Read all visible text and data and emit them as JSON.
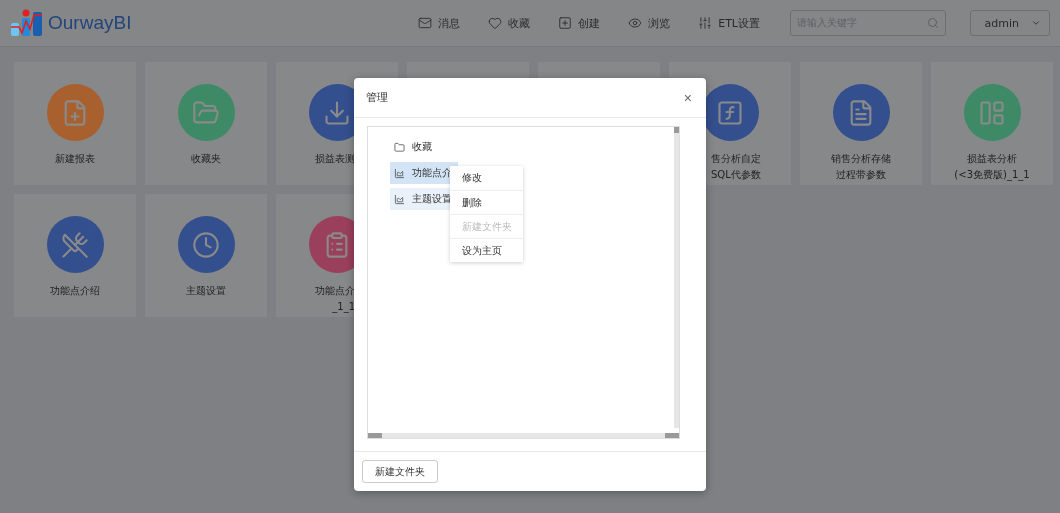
{
  "header": {
    "logo": "OurwayBI",
    "nav": [
      {
        "label": "消息"
      },
      {
        "label": "收藏"
      },
      {
        "label": "创建"
      },
      {
        "label": "浏览"
      },
      {
        "label": "ETL设置"
      }
    ],
    "search": {
      "placeholder": "请输入关键字"
    },
    "user": "admin"
  },
  "tiles": [
    {
      "kind": "app",
      "lines": [
        "新建报表"
      ],
      "color": "#a8602f"
    },
    {
      "kind": "app",
      "lines": [
        "收藏夹"
      ],
      "color": "#3e8a66"
    },
    {
      "kind": "cut_right",
      "lines": [
        "损益表测"
      ],
      "color": "#344f8e"
    },
    {
      "kind": "covered"
    },
    {
      "kind": "covered"
    },
    {
      "kind": "cut_left",
      "lines": [
        "售分析自定",
        "SQL代参数"
      ],
      "color": "#344f8e"
    },
    {
      "kind": "app",
      "lines": [
        "销售分析存储",
        "过程带参数"
      ],
      "color": "#344f8e"
    },
    {
      "kind": "app",
      "lines": [
        "损益表分析",
        "(<3免费版)_1_1"
      ],
      "color": "#3e8a66"
    },
    {
      "kind": "app",
      "lines": [
        "功能点介绍"
      ],
      "color": "#344f8e"
    },
    {
      "kind": "app",
      "lines": [
        "主题设置"
      ],
      "color": "#344f8e"
    },
    {
      "kind": "cut_right",
      "lines": [
        "功能点介",
        "_1_1"
      ],
      "color": "#9a3f5c"
    }
  ],
  "modal": {
    "title": "管理",
    "close": "×",
    "tree": [
      {
        "kind": "folder",
        "label": "收藏",
        "selected": false,
        "hovered": false
      },
      {
        "kind": "report",
        "label": "功能点介",
        "selected": true,
        "hovered": false
      },
      {
        "kind": "report",
        "label": "主题设置",
        "selected": false,
        "hovered": true
      }
    ],
    "menu": [
      {
        "label": "修改",
        "disabled": false
      },
      {
        "label": "删除",
        "disabled": false
      },
      {
        "label": "新建文件夹",
        "disabled": true
      },
      {
        "label": "设为主页",
        "disabled": false
      }
    ],
    "button": "新建文件夹"
  }
}
